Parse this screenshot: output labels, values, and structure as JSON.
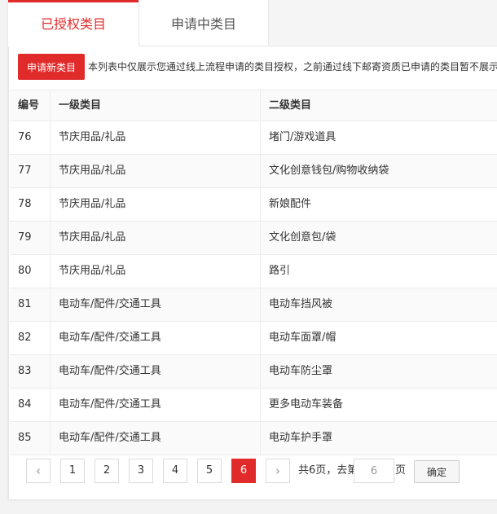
{
  "tabs": {
    "authorized": "已授权类目",
    "applying": "申请中类目"
  },
  "notice": {
    "apply_button": "申请新类目",
    "text": "本列表中仅展示您通过线上流程申请的类目授权，之前通过线下邮寄资质已申请的类目暂不展示"
  },
  "table": {
    "headers": {
      "no": "编号",
      "level1": "一级类目",
      "level2": "二级类目"
    },
    "rows": [
      {
        "no": "76",
        "level1": "节庆用品/礼品",
        "level2": "堵门/游戏道具"
      },
      {
        "no": "77",
        "level1": "节庆用品/礼品",
        "level2": "文化创意钱包/购物收纳袋"
      },
      {
        "no": "78",
        "level1": "节庆用品/礼品",
        "level2": "新娘配件"
      },
      {
        "no": "79",
        "level1": "节庆用品/礼品",
        "level2": "文化创意包/袋"
      },
      {
        "no": "80",
        "level1": "节庆用品/礼品",
        "level2": "路引"
      },
      {
        "no": "81",
        "level1": "电动车/配件/交通工具",
        "level2": "电动车挡风被"
      },
      {
        "no": "82",
        "level1": "电动车/配件/交通工具",
        "level2": "电动车面罩/帽"
      },
      {
        "no": "83",
        "level1": "电动车/配件/交通工具",
        "level2": "电动车防尘罩"
      },
      {
        "no": "84",
        "level1": "电动车/配件/交通工具",
        "level2": "更多电动车装备"
      },
      {
        "no": "85",
        "level1": "电动车/配件/交通工具",
        "level2": "电动车护手罩"
      }
    ]
  },
  "pagination": {
    "prev": "‹",
    "next": "›",
    "pages": [
      "1",
      "2",
      "3",
      "4",
      "5",
      "6"
    ],
    "current": "6",
    "total_text": "共6页，去第",
    "page_suffix": "页",
    "goto_value": "6",
    "confirm": "确定"
  },
  "colors": {
    "accent": "#e12b2b"
  }
}
